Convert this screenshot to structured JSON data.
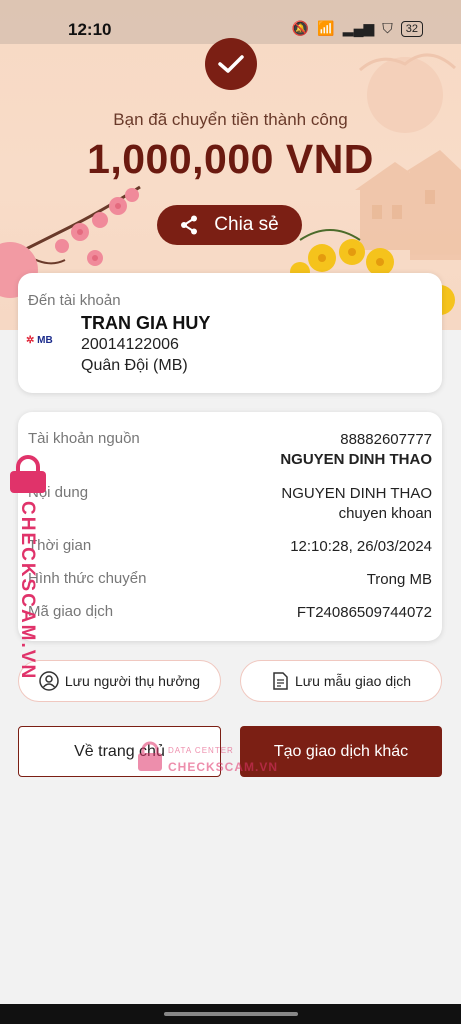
{
  "status": {
    "time": "12:10",
    "battery": "32"
  },
  "header": {
    "success_text": "Bạn đã chuyển tiền thành công",
    "amount": "1,000,000 VND",
    "share_label": "Chia sẻ"
  },
  "recipient": {
    "label": "Đến tài khoản",
    "bank_logo": "MB",
    "name": "TRAN GIA HUY",
    "account": "20014122006",
    "bank": "Quân Đội (MB)"
  },
  "details": {
    "source_label": "Tài khoản nguồn",
    "source_account": "88882607777",
    "source_name": "NGUYEN DINH THAO",
    "content_label": "Nội dung",
    "content_line1": "NGUYEN DINH THAO",
    "content_line2": "chuyen khoan",
    "time_label": "Thời gian",
    "time_value": "12:10:28, 26/03/2024",
    "method_label": "Hình thức chuyển",
    "method_value": "Trong MB",
    "txn_label": "Mã giao dịch",
    "txn_value": "FT24086509744072"
  },
  "actions": {
    "save_beneficiary": "Lưu người thụ hưởng",
    "save_template": "Lưu mẫu giao dịch",
    "home": "Về trang chủ",
    "new_txn": "Tạo giao dịch khác"
  },
  "watermark": {
    "brand": "CHECKSCAM.VN",
    "sub": "DATA CENTER"
  },
  "colors": {
    "accent": "#7b1f14",
    "watermark": "#e0336a"
  }
}
